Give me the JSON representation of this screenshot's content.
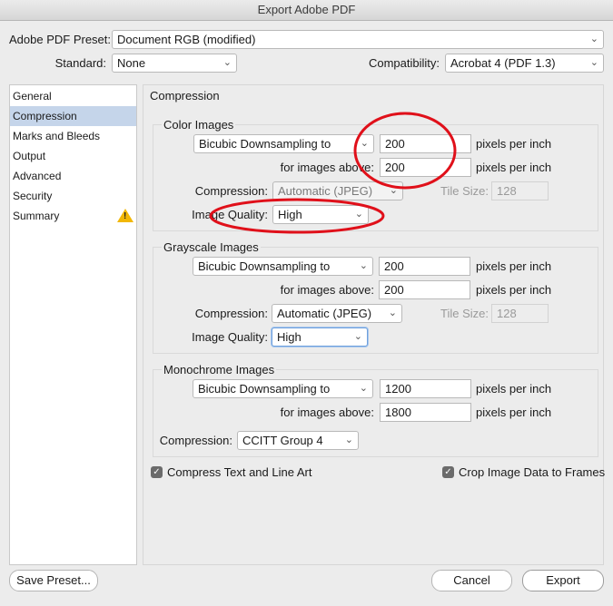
{
  "window": {
    "title": "Export Adobe PDF"
  },
  "header": {
    "preset_label": "Adobe PDF Preset:",
    "preset_value": "Document RGB (modified)",
    "standard_label": "Standard:",
    "standard_value": "None",
    "compat_label": "Compatibility:",
    "compat_value": "Acrobat 4 (PDF 1.3)"
  },
  "sidebar": {
    "items": [
      {
        "label": "General"
      },
      {
        "label": "Compression"
      },
      {
        "label": "Marks and Bleeds"
      },
      {
        "label": "Output"
      },
      {
        "label": "Advanced"
      },
      {
        "label": "Security"
      },
      {
        "label": "Summary"
      }
    ],
    "warning_icon": "warning-icon"
  },
  "main": {
    "section_title": "Compression",
    "color": {
      "title": "Color Images",
      "sampling": "Bicubic Downsampling to",
      "ppi": "200",
      "ppi_unit": "pixels per inch",
      "above_label": "for images above:",
      "above": "200",
      "above_unit": "pixels per inch",
      "compression_label": "Compression:",
      "compression": "Automatic (JPEG)",
      "tile_label": "Tile Size:",
      "tile": "128",
      "quality_label": "Image Quality:",
      "quality": "High"
    },
    "gray": {
      "title": "Grayscale Images",
      "sampling": "Bicubic Downsampling to",
      "ppi": "200",
      "ppi_unit": "pixels per inch",
      "above_label": "for images above:",
      "above": "200",
      "above_unit": "pixels per inch",
      "compression_label": "Compression:",
      "compression": "Automatic (JPEG)",
      "tile_label": "Tile Size:",
      "tile": "128",
      "quality_label": "Image Quality:",
      "quality": "High"
    },
    "mono": {
      "title": "Monochrome Images",
      "sampling": "Bicubic Downsampling to",
      "ppi": "1200",
      "ppi_unit": "pixels per inch",
      "above_label": "for images above:",
      "above": "1800",
      "above_unit": "pixels per inch",
      "compression_label": "Compression:",
      "compression": "CCITT Group 4"
    },
    "compress_text_label": "Compress Text and Line Art",
    "crop_label": "Crop Image Data to Frames"
  },
  "footer": {
    "save_preset": "Save Preset...",
    "cancel": "Cancel",
    "export": "Export"
  },
  "colors": {
    "annotation": "#e0101a",
    "selection": "#c5d5ea"
  }
}
